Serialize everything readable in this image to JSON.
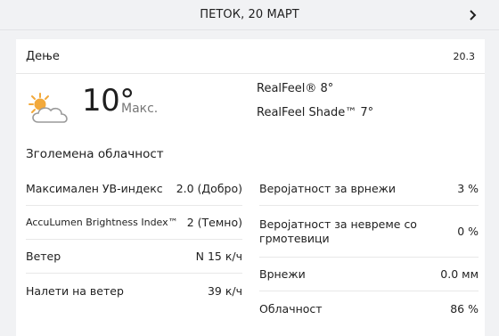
{
  "header": {
    "date_label": "ПЕТОК, 20 МАРТ",
    "next_icon": "chevron-right-icon"
  },
  "card": {
    "period_label": "Дење",
    "date_short": "20.3",
    "weather_icon": "partly-cloudy-sun-icon",
    "temperature": "10°",
    "temperature_label": "Макс.",
    "realfeel": "RealFeel® 8°",
    "realfeel_shade": "RealFeel Shade™ 7°",
    "phrase": "Зголемена облачност",
    "left_details": [
      {
        "label": "Максимален УВ-индекс",
        "value": "2.0 (Добро)"
      },
      {
        "label": "AccuLumen Brightness Index™",
        "value": "2 (Темно)"
      },
      {
        "label": "Ветер",
        "value": "N 15 к/ч"
      },
      {
        "label": "Налети на ветер",
        "value": "39 к/ч"
      }
    ],
    "right_details": [
      {
        "label": "Веројатност за врнежи",
        "value": "3 %"
      },
      {
        "label": "Веројатност за невреме со грмотевици",
        "value": "0 %"
      },
      {
        "label": "Врнежи",
        "value": "0.0 мм"
      },
      {
        "label": "Облачност",
        "value": "86 %"
      }
    ]
  }
}
